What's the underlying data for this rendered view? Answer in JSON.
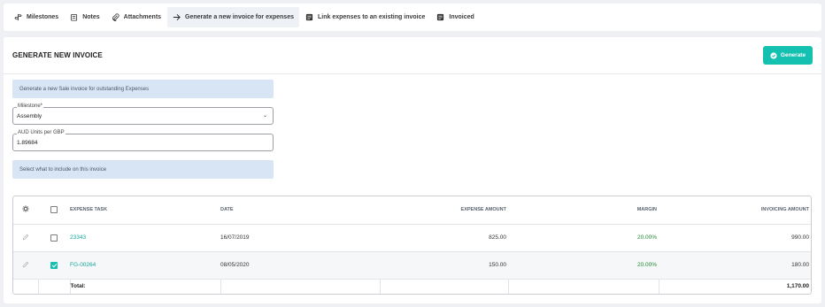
{
  "tabs": [
    {
      "label": "Milestones",
      "icon": "milestones-icon",
      "active": false
    },
    {
      "label": "Notes",
      "icon": "notes-icon",
      "active": false
    },
    {
      "label": "Attachments",
      "icon": "paperclip-icon",
      "active": false
    },
    {
      "label": "Generate a new invoice for expenses",
      "icon": "arrow-right-icon",
      "active": true
    },
    {
      "label": "Link expenses to an existing invoice",
      "icon": "list-icon",
      "active": false
    },
    {
      "label": "Invoiced",
      "icon": "invoice-icon",
      "active": false
    }
  ],
  "panel": {
    "title": "GENERATE NEW INVOICE",
    "generate_label": "Generate",
    "info_text": "Generate a new Sale invoice for outstanding Expenses",
    "milestone": {
      "label": "Milestone*",
      "value": "Assembly"
    },
    "rate": {
      "label": "AUD Units per GBP",
      "value": "1.89684"
    },
    "include_text": "Select what to include on this invoice"
  },
  "table": {
    "headers": {
      "task": "EXPENSE TASK",
      "date": "DATE",
      "amount": "EXPENSE AMOUNT",
      "margin": "MARGIN",
      "invoicing": "INVOICING AMOUNT"
    },
    "rows": [
      {
        "task": "23343",
        "date": "16/07/2019",
        "amount": "825.00",
        "margin": "20.00%",
        "invoicing": "990.00",
        "checked": false
      },
      {
        "task": "FG-00264",
        "date": "08/05/2020",
        "amount": "150.00",
        "margin": "20.00%",
        "invoicing": "180.00",
        "checked": true
      }
    ],
    "total_label": "Total:",
    "total_value": "1,170.00"
  },
  "colors": {
    "accent": "#14c0b0",
    "info_bg": "#d7e5f5",
    "margin_green": "#1d8a2f"
  }
}
